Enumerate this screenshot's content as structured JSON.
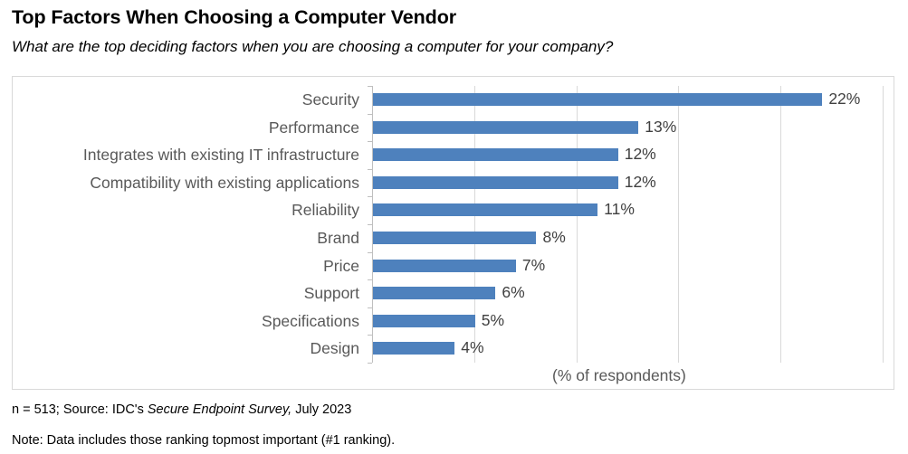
{
  "title": "Top Factors When Choosing a Computer Vendor",
  "subtitle": "What are the top deciding factors when you are choosing a computer for your company?",
  "axis_title": "(% of respondents)",
  "footnotes": {
    "source_prefix": "n = 513; Source: IDC's ",
    "source_italic": "Secure Endpoint Survey,",
    "source_suffix": " July 2023",
    "note": "Note: Data includes those ranking topmost important  (#1 ranking)."
  },
  "colors": {
    "bar": "#4e81bd",
    "label_text": "#595959",
    "value_text": "#404040",
    "gridline": "#d9d9d9",
    "axis_line": "#bfbfbf",
    "frame_border": "#d9d9d9",
    "background": "#ffffff"
  },
  "chart_data": {
    "type": "bar",
    "orientation": "horizontal",
    "title": "Top Factors When Choosing a Computer Vendor",
    "subtitle": "What are the top deciding factors when you are choosing a computer for your company?",
    "xlabel": "(% of respondents)",
    "ylabel": "",
    "xlim": [
      0,
      25
    ],
    "grid": "vertical",
    "gridline_values": [
      5,
      10,
      15,
      20,
      25
    ],
    "legend": "none",
    "value_suffix": "%",
    "categories": [
      "Security",
      "Performance",
      "Integrates with existing IT infrastructure",
      "Compatibility with existing applications",
      "Reliability",
      "Brand",
      "Price",
      "Support",
      "Specifications",
      "Design"
    ],
    "values": [
      22,
      13,
      12,
      12,
      11,
      8,
      7,
      6,
      5,
      4
    ],
    "labels": [
      "22%",
      "13%",
      "12%",
      "12%",
      "11%",
      "8%",
      "7%",
      "6%",
      "5%",
      "4%"
    ],
    "notes": [
      "n = 513; Source: IDC's Secure Endpoint Survey, July 2023",
      "Note: Data includes those ranking topmost important  (#1 ranking)."
    ]
  }
}
